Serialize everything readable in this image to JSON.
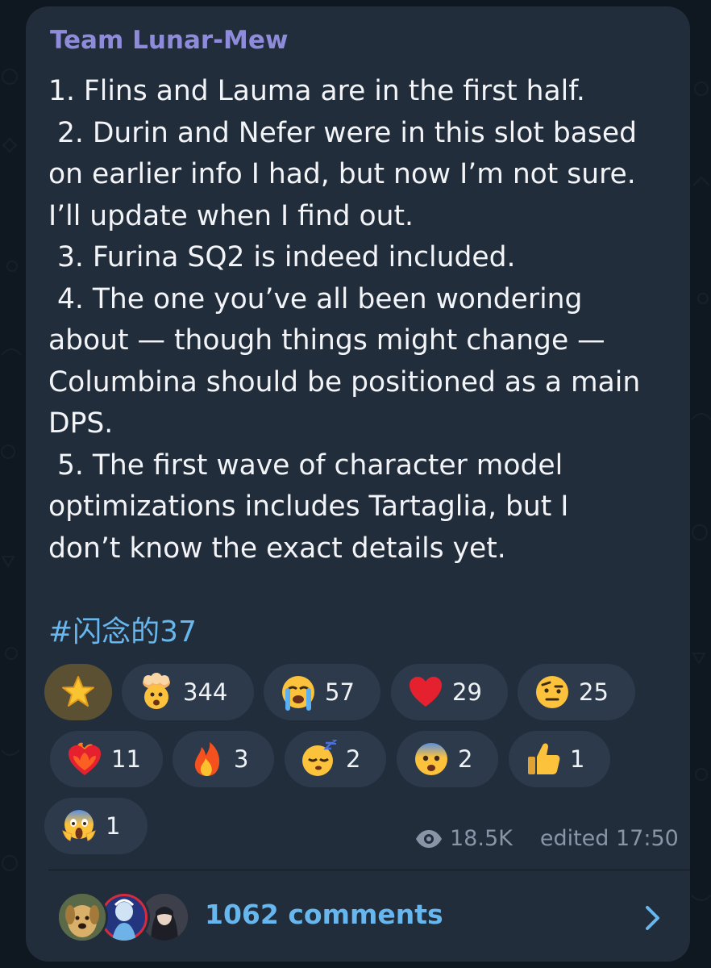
{
  "channel": {
    "name": "Team Lunar-Mew"
  },
  "message": {
    "lines": [
      "1. Flins and Lauma are in the first half.",
      " 2. Durin and Nefer were in this slot based",
      "on earlier info I had, but now I’m not sure.",
      "I’ll update when I find out.",
      " 3. Furina SQ2 is indeed included.",
      " 4. The one you’ve all been wondering",
      "about — though things might change —",
      "Columbina should be positioned as a main",
      "DPS.",
      " 5. The first wave of character model",
      "optimizations includes Tartaglia, but I",
      "don’t know the exact details yet."
    ],
    "hashtag": "#闪念的37"
  },
  "reactions": [
    {
      "icon": "star-icon",
      "count": ""
    },
    {
      "icon": "exploding-head-icon",
      "count": "344"
    },
    {
      "icon": "loudly-crying-face-icon",
      "count": "57"
    },
    {
      "icon": "red-heart-icon",
      "count": "29"
    },
    {
      "icon": "face-with-raised-eyebrow-icon",
      "count": "25"
    },
    {
      "icon": "heart-on-fire-icon",
      "count": "11"
    },
    {
      "icon": "fire-icon",
      "count": "3"
    },
    {
      "icon": "sleeping-face-icon",
      "count": "2"
    },
    {
      "icon": "anxious-face-icon",
      "count": "2"
    },
    {
      "icon": "thumbs-up-icon",
      "count": "1"
    },
    {
      "icon": "screaming-face-icon",
      "count": "1"
    }
  ],
  "meta": {
    "views": "18.5K",
    "edited": "edited 17:50",
    "view_icon": "eye-icon"
  },
  "comments": {
    "label": "1062 comments",
    "icon": "chevron-right-icon"
  },
  "colors": {
    "background": "#0f1720",
    "bubble": "#212d3b",
    "channel_name": "#8f8bdb",
    "link": "#67b7ee",
    "reaction_chip": "#2c3a4b",
    "reaction_chip_active": "#5b5132",
    "meta_text": "#8795a7"
  }
}
